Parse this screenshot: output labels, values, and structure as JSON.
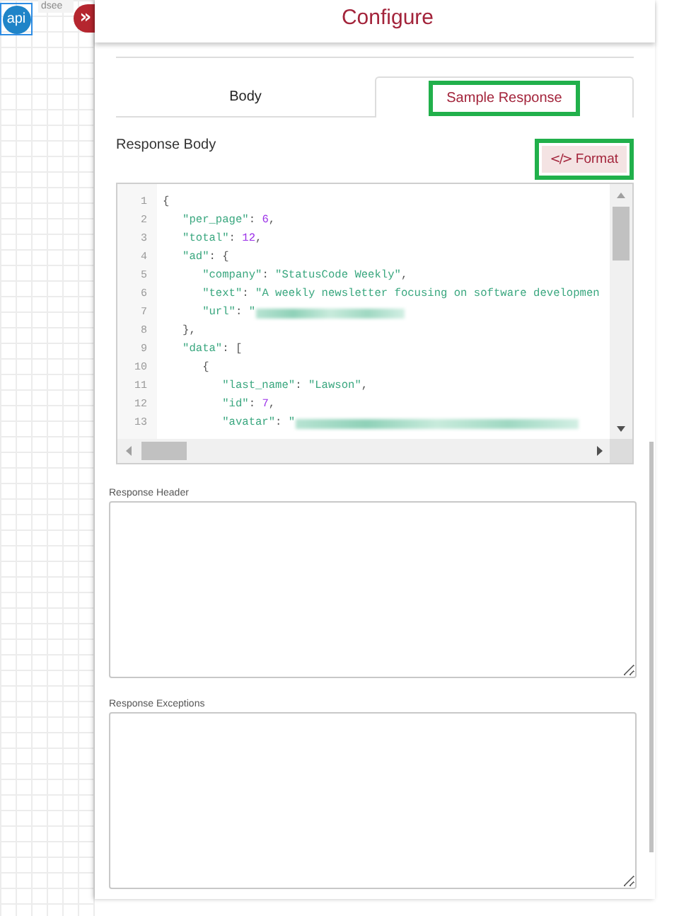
{
  "canvas": {
    "node": {
      "icon_text": "api",
      "label": "dsee",
      "selected": true
    }
  },
  "collapse_button": {
    "glyph": "»"
  },
  "panel": {
    "title": "Configure",
    "tabs": [
      {
        "label": "Body",
        "selected": false,
        "highlighted": false
      },
      {
        "label": "Sample Response",
        "selected": true,
        "highlighted": true
      }
    ],
    "response_body": {
      "label": "Response Body",
      "format_button": {
        "icon": "</>",
        "label": "Format",
        "highlighted": true
      },
      "code_lines": [
        {
          "number": "1",
          "tokens": [
            {
              "kind": "punct",
              "text": "{"
            }
          ]
        },
        {
          "number": "2",
          "tokens": [
            {
              "kind": "key",
              "text": "   \"per_page\""
            },
            {
              "kind": "punct",
              "text": ": "
            },
            {
              "kind": "number",
              "text": "6"
            },
            {
              "kind": "punct",
              "text": ","
            }
          ]
        },
        {
          "number": "3",
          "tokens": [
            {
              "kind": "key",
              "text": "   \"total\""
            },
            {
              "kind": "punct",
              "text": ": "
            },
            {
              "kind": "number",
              "text": "12"
            },
            {
              "kind": "punct",
              "text": ","
            }
          ]
        },
        {
          "number": "4",
          "tokens": [
            {
              "kind": "key",
              "text": "   \"ad\""
            },
            {
              "kind": "punct",
              "text": ": {"
            }
          ]
        },
        {
          "number": "5",
          "tokens": [
            {
              "kind": "key",
              "text": "      \"company\""
            },
            {
              "kind": "punct",
              "text": ": "
            },
            {
              "kind": "string",
              "text": "\"StatusCode Weekly\""
            },
            {
              "kind": "punct",
              "text": ","
            }
          ]
        },
        {
          "number": "6",
          "tokens": [
            {
              "kind": "key",
              "text": "      \"text\""
            },
            {
              "kind": "punct",
              "text": ": "
            },
            {
              "kind": "string",
              "text": "\"A weekly newsletter focusing on software developmen"
            }
          ]
        },
        {
          "number": "7",
          "tokens": [
            {
              "kind": "key",
              "text": "      \"url\""
            },
            {
              "kind": "punct",
              "text": ": "
            },
            {
              "kind": "string",
              "text": "\""
            },
            {
              "kind": "redacted"
            }
          ]
        },
        {
          "number": "8",
          "tokens": [
            {
              "kind": "punct",
              "text": "   },"
            }
          ]
        },
        {
          "number": "9",
          "tokens": [
            {
              "kind": "key",
              "text": "   \"data\""
            },
            {
              "kind": "punct",
              "text": ": ["
            }
          ]
        },
        {
          "number": "10",
          "tokens": [
            {
              "kind": "punct",
              "text": "      {"
            }
          ]
        },
        {
          "number": "11",
          "tokens": [
            {
              "kind": "key",
              "text": "         \"last_name\""
            },
            {
              "kind": "punct",
              "text": ": "
            },
            {
              "kind": "string",
              "text": "\"Lawson\""
            },
            {
              "kind": "punct",
              "text": ","
            }
          ]
        },
        {
          "number": "12",
          "tokens": [
            {
              "kind": "key",
              "text": "         \"id\""
            },
            {
              "kind": "punct",
              "text": ": "
            },
            {
              "kind": "number",
              "text": "7"
            },
            {
              "kind": "punct",
              "text": ","
            }
          ]
        },
        {
          "number": "13",
          "tokens": [
            {
              "kind": "key",
              "text": "         \"avatar\""
            },
            {
              "kind": "punct",
              "text": ": "
            },
            {
              "kind": "string",
              "text": "\""
            },
            {
              "kind": "redacted_long"
            }
          ]
        }
      ]
    },
    "response_header": {
      "label": "Response Header"
    },
    "response_exceptions": {
      "label": "Response Exceptions"
    }
  }
}
